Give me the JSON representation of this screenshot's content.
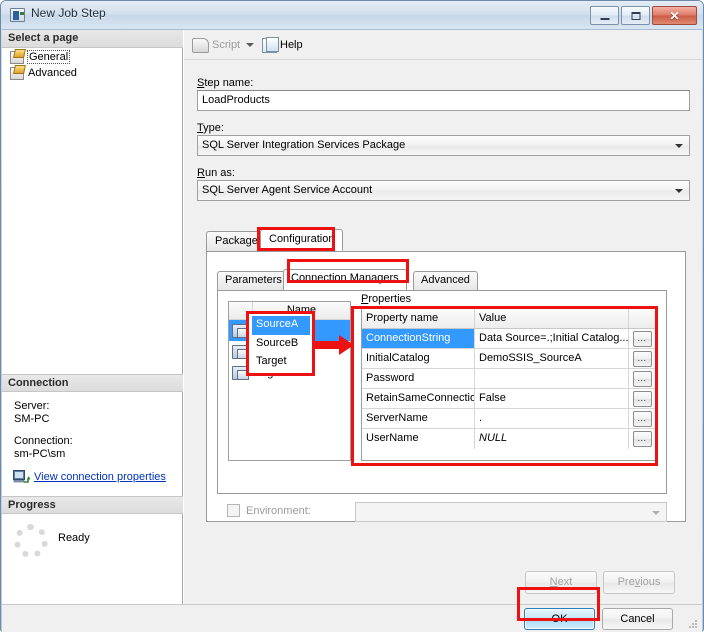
{
  "window": {
    "title": "New Job Step",
    "icon": "job-step-icon",
    "buttons": {
      "minimize": "minimize-icon",
      "maximize": "maximize-icon",
      "close": "close-icon"
    }
  },
  "sidebar": {
    "header": "Select a page",
    "items": [
      {
        "label": "General",
        "icon": "page-icon",
        "selected": true
      },
      {
        "label": "Advanced",
        "icon": "page-icon",
        "selected": false
      }
    ],
    "connection": {
      "header": "Connection",
      "server_label": "Server:",
      "server_value": "SM-PC",
      "connection_label": "Connection:",
      "connection_value": "sm-PC\\sm",
      "link": "View connection properties",
      "link_icon": "server-connection-icon"
    },
    "progress": {
      "header": "Progress",
      "status": "Ready",
      "icon": "progress-spinner-icon"
    }
  },
  "toolbar": {
    "script_label": "Script",
    "script_icon": "script-icon",
    "script_dropdown_icon": "chevron-down-icon",
    "help_label": "Help",
    "help_icon": "help-icon"
  },
  "form": {
    "step_name_label": "Step name:",
    "step_name_value": "LoadProducts",
    "type_label": "Type:",
    "type_value": "SQL Server Integration Services Package",
    "run_as_label": "Run as:",
    "run_as_value": "SQL Server Agent Service Account"
  },
  "outer_tabs": {
    "items": [
      {
        "label": "Package",
        "selected": false
      },
      {
        "label": "Configuration",
        "selected": true
      }
    ]
  },
  "inner_tabs": {
    "items": [
      {
        "label": "Parameters",
        "selected": false
      },
      {
        "label": "Connection Managers",
        "selected": true
      },
      {
        "label": "Advanced",
        "selected": false
      }
    ]
  },
  "connection_managers": {
    "column_header": "Name",
    "rows": [
      {
        "name": "SourceA",
        "icon": "connection-manager-icon",
        "selected": true
      },
      {
        "name": "SourceB",
        "icon": "connection-manager-icon",
        "selected": false
      },
      {
        "name": "Target",
        "icon": "connection-manager-icon",
        "selected": false
      }
    ]
  },
  "properties": {
    "label": "Properties",
    "headers": {
      "name": "Property name",
      "value": "Value"
    },
    "ellipsis_label": "...",
    "rows": [
      {
        "name": "ConnectionString",
        "value": "Data Source=.;Initial Catalog...",
        "selected": true,
        "italic": false
      },
      {
        "name": "InitialCatalog",
        "value": "DemoSSIS_SourceA",
        "selected": false,
        "italic": false
      },
      {
        "name": "Password",
        "value": "",
        "selected": false,
        "italic": false
      },
      {
        "name": "RetainSameConnection",
        "value": "False",
        "selected": false,
        "italic": false
      },
      {
        "name": "ServerName",
        "value": ".",
        "selected": false,
        "italic": false
      },
      {
        "name": "UserName",
        "value": "NULL",
        "selected": false,
        "italic": true
      }
    ]
  },
  "environment": {
    "label": "Environment:",
    "checked": false,
    "value": "",
    "dropdown_icon": "chevron-down-icon"
  },
  "nav_buttons": {
    "next": "Next",
    "previous": "Previous"
  },
  "dialog_buttons": {
    "ok": "OK",
    "cancel": "Cancel"
  },
  "annotations": {
    "color": "#ee1111",
    "highlights": [
      "Configuration tab",
      "Connection Managers tab",
      "connection manager names",
      "properties grid",
      "OK button"
    ],
    "arrow_icon": "right-arrow-icon"
  }
}
